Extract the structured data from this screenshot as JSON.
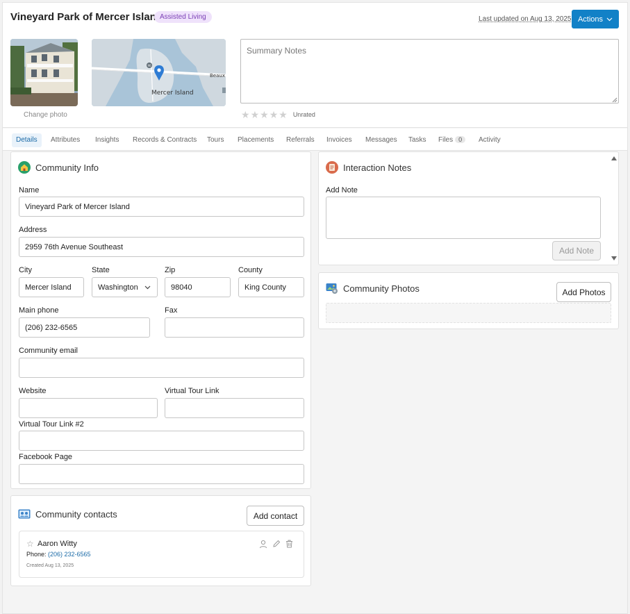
{
  "header": {
    "title": "Vineyard Park of Mercer Island",
    "badge": "Assisted Living",
    "last_updated": "Last updated on Aug 13, 2025",
    "actions_label": "Actions"
  },
  "photo": {
    "change_label": "Change photo"
  },
  "map": {
    "place_label": "Mercer Island",
    "area_label": "Beaux Arts Villa",
    "route_label": "90"
  },
  "summary": {
    "placeholder": "Summary Notes",
    "rating_label": "Unrated",
    "rating": 0
  },
  "tabs": [
    {
      "label": "Details"
    },
    {
      "label": "Attributes"
    },
    {
      "label": "Insights"
    },
    {
      "label": "Records & Contracts"
    },
    {
      "label": "Tours"
    },
    {
      "label": "Placements"
    },
    {
      "label": "Referrals"
    },
    {
      "label": "Invoices"
    },
    {
      "label": "Messages"
    },
    {
      "label": "Tasks"
    },
    {
      "label": "Files",
      "count": "0"
    },
    {
      "label": "Activity"
    }
  ],
  "community_info": {
    "title": "Community Info",
    "name_label": "Name",
    "name_value": "Vineyard Park of Mercer Island",
    "address_label": "Address",
    "address_value": "2959 76th Avenue Southeast",
    "city_label": "City",
    "city_value": "Mercer Island",
    "state_label": "State",
    "state_value": "Washington",
    "zip_label": "Zip",
    "zip_value": "98040",
    "county_label": "County",
    "county_value": "King County",
    "phone_label": "Main phone",
    "phone_value": "(206) 232-6565",
    "fax_label": "Fax",
    "fax_value": "",
    "email_label": "Community email",
    "email_value": "",
    "website_label": "Website",
    "website_value": "",
    "vtour_label": "Virtual Tour Link",
    "vtour_value": "",
    "vtour2_label": "Virtual Tour Link #2",
    "vtour2_value": "",
    "facebook_label": "Facebook Page",
    "facebook_value": ""
  },
  "interaction_notes": {
    "title": "Interaction Notes",
    "add_note_label": "Add Note",
    "add_note_button": "Add Note"
  },
  "community_photos": {
    "title": "Community Photos",
    "add_button": "Add Photos"
  },
  "contacts": {
    "title": "Community contacts",
    "add_button": "Add contact",
    "items": [
      {
        "name": "Aaron Witty",
        "phone_label": "Phone:",
        "phone": "(206) 232-6565",
        "created": "Created Aug 13, 2025"
      }
    ]
  },
  "colors": {
    "accent": "#1281c7",
    "badge_bg": "#efe2fb",
    "badge_text": "#7b3fb5"
  }
}
